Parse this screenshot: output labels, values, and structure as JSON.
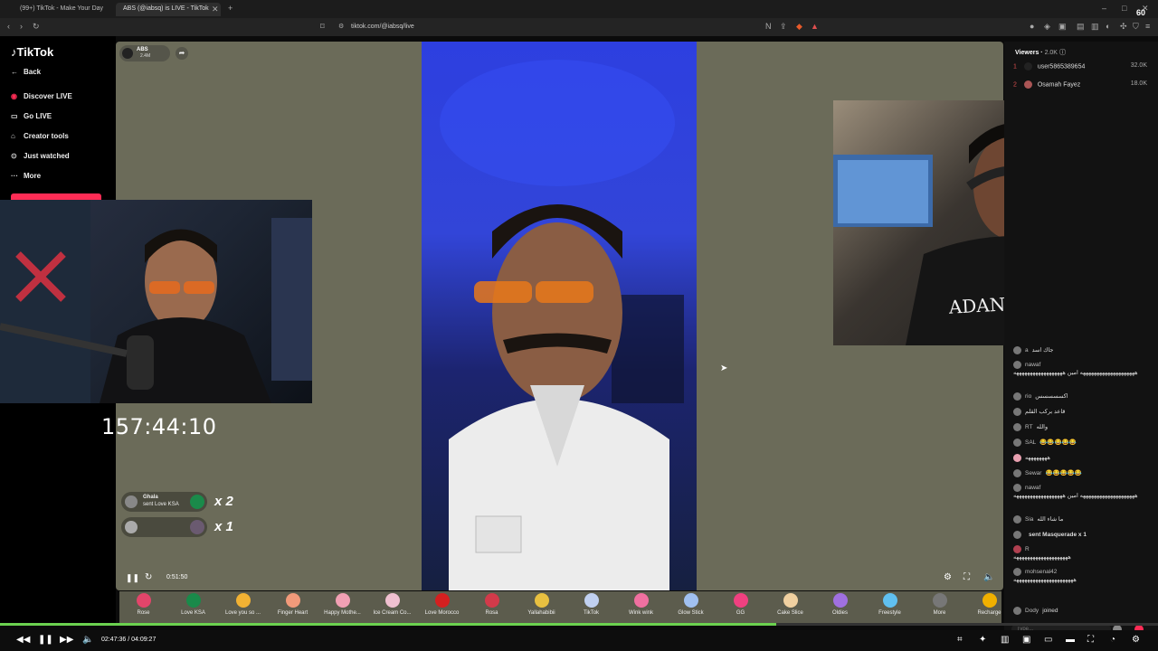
{
  "browser": {
    "tabs": [
      {
        "label": "(99+) TikTok - Make Your Day"
      },
      {
        "label": "ABS (@iabsq) is LIVE - TikTok"
      }
    ],
    "url": "tiktok.com/@iabsq/live",
    "fps": "60"
  },
  "sidebar": {
    "logo": "TikTok",
    "items": [
      {
        "label": "Back",
        "icon": "arrow-left-icon"
      },
      {
        "label": "Discover LIVE",
        "icon": "live-icon"
      },
      {
        "label": "Go LIVE",
        "icon": "camera-icon"
      },
      {
        "label": "Creator tools",
        "icon": "home-icon"
      },
      {
        "label": "Just watched",
        "icon": "history-icon"
      },
      {
        "label": "More",
        "icon": "more-icon"
      }
    ]
  },
  "stream": {
    "host_name": "ABS",
    "host_likes": "2.4M",
    "elapsed": "0:51:50"
  },
  "overlay": {
    "timer": "157:44:10"
  },
  "gift_alerts": [
    {
      "user": "Ghala",
      "text": "sent Love KSA",
      "mult": "x 2"
    },
    {
      "user": "",
      "text": "",
      "mult": "x 1"
    }
  ],
  "viewers": {
    "title": "Viewers",
    "count": "2.0K",
    "list": [
      {
        "rank": "1",
        "name": "user5865389654",
        "score": "32.0K"
      },
      {
        "rank": "2",
        "name": "Osamah Fayez",
        "score": "18.0K"
      }
    ]
  },
  "chat": [
    {
      "name": "a",
      "msg": "جاك اسد"
    },
    {
      "name": "nawaf",
      "msg": "ههههههههههههههههههههه امين ههههههههههههههههههه"
    },
    {
      "name": "rio",
      "msg": "اكسسسسس"
    },
    {
      "name": "",
      "msg": "قاعد بركب القلم"
    },
    {
      "name": "RT",
      "msg": "والله"
    },
    {
      "name": "SAL",
      "msg": "😂😂😂😂😂"
    },
    {
      "name": "",
      "msg": "ههههههههه"
    },
    {
      "name": "Sewar",
      "msg": "😂😂😂😂😂"
    },
    {
      "name": "nawaf",
      "msg": "ههههههههههههههههههههه امين ههههههههههههههههههه"
    },
    {
      "name": "Sia",
      "msg": "ما شاء الله"
    },
    {
      "name": "",
      "msg": "sent Masquerade x 1"
    },
    {
      "name": "R",
      "msg": "ههههههههههههههههههههه"
    },
    {
      "name": "mohsenal42",
      "msg": "ههههههههههههههههههههههه"
    },
    {
      "name": "Dody",
      "msg": "joined"
    }
  ],
  "chat_input_placeholder": "Type...",
  "gifts": [
    {
      "label": "Rose",
      "color": "#e2456a"
    },
    {
      "label": "Love KSA",
      "color": "#1a8a4a"
    },
    {
      "label": "Love you so ...",
      "color": "#f2b233"
    },
    {
      "label": "Finger Heart",
      "color": "#f29a7a"
    },
    {
      "label": "Happy Mothe...",
      "color": "#f2a0b4"
    },
    {
      "label": "Ice Cream Co...",
      "color": "#f0c0d0"
    },
    {
      "label": "Love Morocco",
      "color": "#d42020"
    },
    {
      "label": "Rosa",
      "color": "#d23a4a"
    },
    {
      "label": "Yallahabibii",
      "color": "#e8c040"
    },
    {
      "label": "TikTok",
      "color": "#c0d0f0"
    },
    {
      "label": "Wink wink",
      "color": "#f070a0"
    },
    {
      "label": "Glow Stick",
      "color": "#a0c0f0"
    },
    {
      "label": "GG",
      "color": "#f04080"
    },
    {
      "label": "Cake Slice",
      "color": "#f0d0a0"
    },
    {
      "label": "Oldies",
      "color": "#a070e0"
    },
    {
      "label": "Freestyle",
      "color": "#60c0f0"
    },
    {
      "label": "More",
      "color": "#777"
    },
    {
      "label": "Recharge",
      "color": "#f0b000"
    }
  ],
  "player": {
    "current": "02:47:36",
    "total": "04:09:27",
    "progress": 0.67
  },
  "colors": {
    "accent": "#fe2c55",
    "progress": "#6bd14f"
  }
}
